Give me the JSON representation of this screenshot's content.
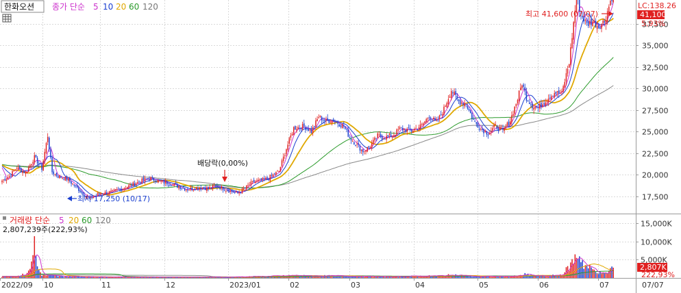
{
  "header": {
    "stock_name": "한화오션",
    "price_label": "종가 단순",
    "ma_periods": [
      "5",
      "10",
      "20",
      "60",
      "120"
    ],
    "lc_label": "LC:138.26"
  },
  "volume_header": {
    "label": "거래량 단순",
    "ma_periods": [
      "5",
      "20",
      "60",
      "120"
    ],
    "info": "2,807,239주(222,93%)"
  },
  "annotations": {
    "high": "최고 41,600 (07/07)",
    "low": "최저 17,250 (10/17)",
    "dividend": "배당락(0,00%)"
  },
  "badges": {
    "price": "41,100",
    "change_pct": "5,93%",
    "volume": "2,807K",
    "volume_pct": "222,93%"
  },
  "colors": {
    "up": "#e02020",
    "down": "#1a3fd0",
    "ma5": "#cc33cc",
    "ma10": "#1a3fd0",
    "ma20": "#e0a800",
    "ma60": "#2a9a2a",
    "ma120": "#888888",
    "grid": "#d9d9d9",
    "badge": "#e02020"
  },
  "chart_data": {
    "type": "candlestick",
    "x_range": [
      "2022-09",
      "2023-07"
    ],
    "month_labels": [
      "2022/09",
      "10",
      "11",
      "12",
      "2023/01",
      "02",
      "03",
      "04",
      "05",
      "06",
      "07",
      "07/07"
    ],
    "price_axis": {
      "ylim": [
        15000,
        42500
      ],
      "ticks": [
        "17,500",
        "20,000",
        "22,500",
        "25,000",
        "27,500",
        "30,000",
        "32,500",
        "35,000",
        "37,500"
      ]
    },
    "volume_axis": {
      "ylim": [
        0,
        16500000
      ],
      "ticks": [
        "5,000K",
        "10,000K",
        "15,000K"
      ]
    },
    "high": {
      "value": 41600,
      "date": "07/07"
    },
    "low": {
      "value": 17250,
      "date": "10/17"
    },
    "last_close": 41100,
    "last_change_pct": 5.93,
    "last_volume": 2807239,
    "price_knots": [
      [
        0,
        19300
      ],
      [
        5,
        19800
      ],
      [
        10,
        20800
      ],
      [
        16,
        20200
      ],
      [
        22,
        22000
      ],
      [
        27,
        20700
      ],
      [
        31,
        24500
      ],
      [
        34,
        20300
      ],
      [
        38,
        19800
      ],
      [
        44,
        19500
      ],
      [
        50,
        18600
      ],
      [
        56,
        17600
      ],
      [
        60,
        17250
      ],
      [
        66,
        17800
      ],
      [
        75,
        18000
      ],
      [
        85,
        18600
      ],
      [
        95,
        19300
      ],
      [
        100,
        19600
      ],
      [
        105,
        19300
      ],
      [
        115,
        18900
      ],
      [
        125,
        18300
      ],
      [
        135,
        18500
      ],
      [
        140,
        18400
      ],
      [
        145,
        18700
      ],
      [
        155,
        18100
      ],
      [
        160,
        17800
      ],
      [
        170,
        19100
      ],
      [
        180,
        19500
      ],
      [
        188,
        20400
      ],
      [
        193,
        23000
      ],
      [
        198,
        25400
      ],
      [
        205,
        25600
      ],
      [
        210,
        25000
      ],
      [
        215,
        26700
      ],
      [
        220,
        26200
      ],
      [
        225,
        26300
      ],
      [
        232,
        25600
      ],
      [
        236,
        24300
      ],
      [
        240,
        23600
      ],
      [
        245,
        22700
      ],
      [
        250,
        23300
      ],
      [
        255,
        24500
      ],
      [
        260,
        24300
      ],
      [
        265,
        24500
      ],
      [
        270,
        25300
      ],
      [
        278,
        25100
      ],
      [
        285,
        25700
      ],
      [
        290,
        26800
      ],
      [
        295,
        26000
      ],
      [
        300,
        27600
      ],
      [
        305,
        29800
      ],
      [
        310,
        28500
      ],
      [
        315,
        28200
      ],
      [
        320,
        26300
      ],
      [
        325,
        25300
      ],
      [
        330,
        24800
      ],
      [
        335,
        25600
      ],
      [
        340,
        25000
      ],
      [
        345,
        26300
      ],
      [
        350,
        28800
      ],
      [
        353,
        30600
      ],
      [
        356,
        28900
      ],
      [
        360,
        28000
      ],
      [
        364,
        27700
      ],
      [
        370,
        28800
      ],
      [
        375,
        29500
      ],
      [
        380,
        29400
      ],
      [
        385,
        33000
      ],
      [
        390,
        40600
      ],
      [
        393,
        38600
      ],
      [
        397,
        37400
      ],
      [
        401,
        37800
      ],
      [
        405,
        37200
      ],
      [
        409,
        37800
      ],
      [
        413,
        40100
      ],
      [
        415,
        41100
      ]
    ],
    "volume_knots": [
      [
        0,
        420000
      ],
      [
        10,
        500000
      ],
      [
        18,
        1500000
      ],
      [
        20,
        5400000
      ],
      [
        22,
        9200000
      ],
      [
        24,
        3000000
      ],
      [
        27,
        800000
      ],
      [
        40,
        450000
      ],
      [
        70,
        300000
      ],
      [
        100,
        250000
      ],
      [
        150,
        220000
      ],
      [
        190,
        550000
      ],
      [
        198,
        700000
      ],
      [
        205,
        600000
      ],
      [
        230,
        550000
      ],
      [
        260,
        350000
      ],
      [
        300,
        600000
      ],
      [
        306,
        900000
      ],
      [
        320,
        400000
      ],
      [
        350,
        500000
      ],
      [
        355,
        1000000
      ],
      [
        360,
        600000
      ],
      [
        370,
        500000
      ],
      [
        380,
        900000
      ],
      [
        385,
        3000000
      ],
      [
        389,
        5500000
      ],
      [
        392,
        6500000
      ],
      [
        395,
        3500000
      ],
      [
        400,
        2500000
      ],
      [
        405,
        1500000
      ],
      [
        410,
        1000000
      ],
      [
        414,
        2807239
      ]
    ]
  }
}
